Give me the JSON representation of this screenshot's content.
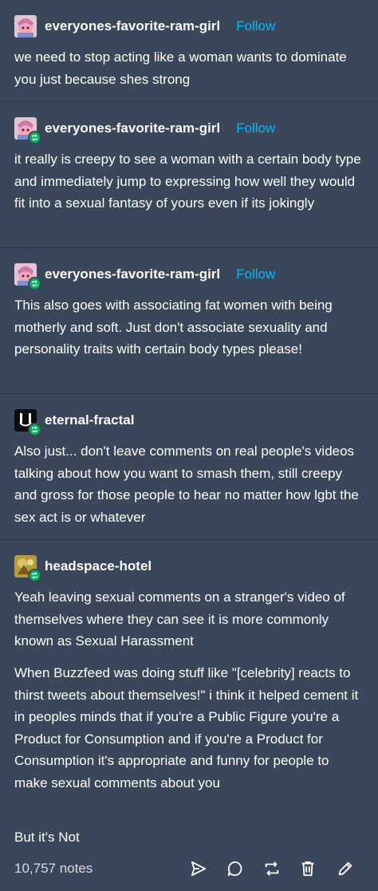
{
  "posts": [
    {
      "username": "everyones-favorite-ram-girl",
      "follow_label": "Follow",
      "text": "we need to stop acting like a woman wants to dominate you just because shes strong"
    },
    {
      "username": "everyones-favorite-ram-girl",
      "follow_label": "Follow",
      "text": "it really is creepy to see a woman with a certain body type and immediately jump to expressing how well they would fit into a sexual fantasy of yours even if its jokingly"
    },
    {
      "username": "everyones-favorite-ram-girl",
      "follow_label": "Follow",
      "text": "This also goes with associating fat women with being motherly and soft. Just don't associate sexuality and personality traits with certain body types please!"
    },
    {
      "username": "eternal-fractal",
      "text": "Also  just... don't leave comments on real people's videos talking about how you want to smash them, still creepy and gross for those people to hear no matter how lgbt the sex act is or whatever"
    },
    {
      "username": "headspace-hotel",
      "paragraphs": [
        "Yeah leaving sexual comments on a stranger's video of themselves where they can see it is more commonly known as Sexual Harassment",
        "When Buzzfeed was doing stuff like \"[celebrity] reacts to thirst tweets about themselves!\" i think it helped cement it in peoples minds that if you're a Public Figure you're a Product for Consumption and if you're a Product for Consumption it's appropriate and funny for people to make sexual comments about you",
        "But it's Not"
      ]
    }
  ],
  "footer": {
    "notes": "10,757 notes",
    "actions": [
      "share-icon",
      "reply-icon",
      "reblog-icon",
      "delete-icon",
      "edit-icon"
    ]
  },
  "colors": {
    "background": "#3a4659",
    "follow": "#00b8ff",
    "reblog_badge": "#00b85c"
  }
}
